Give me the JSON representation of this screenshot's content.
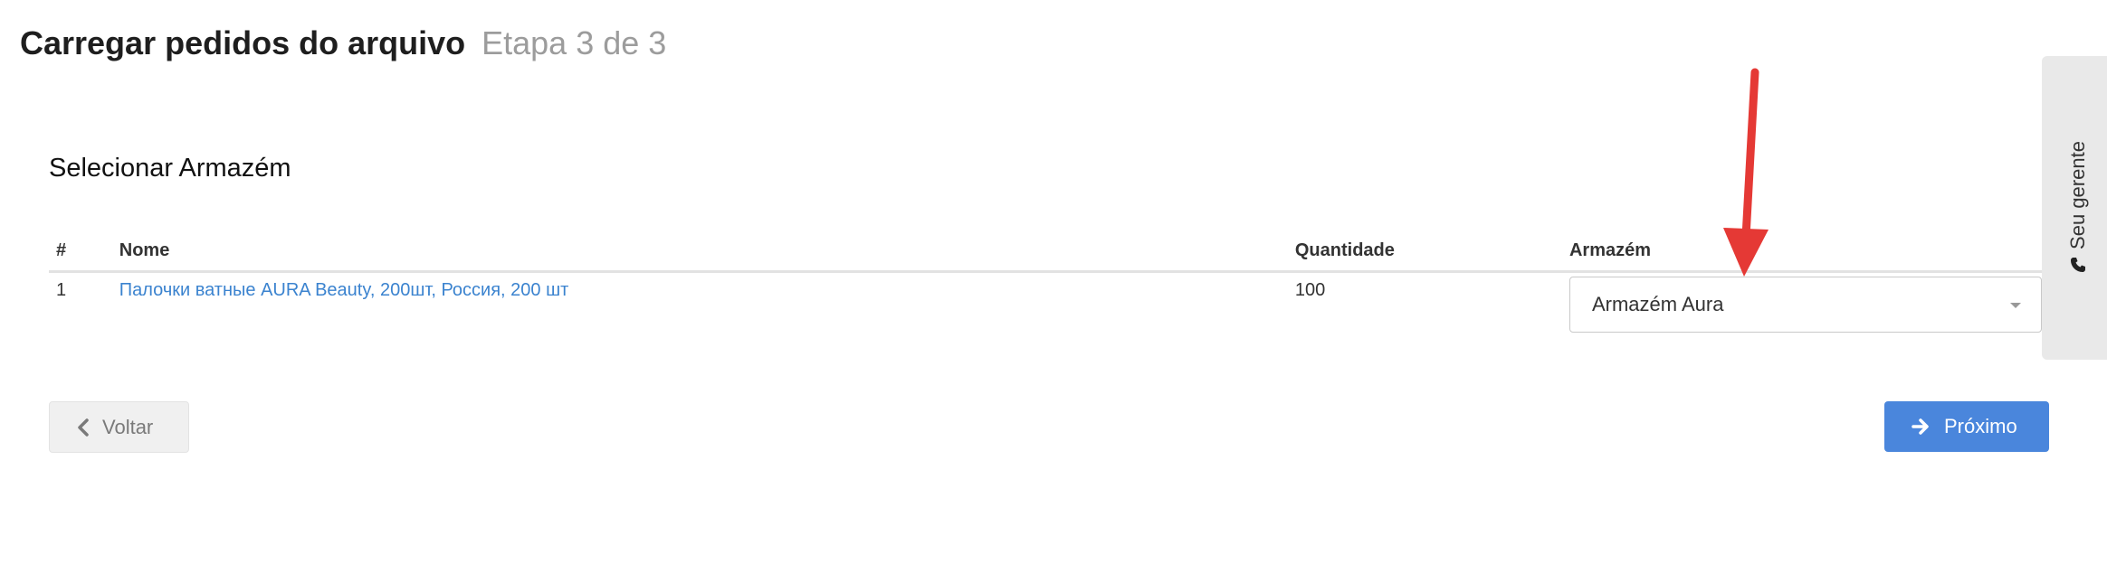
{
  "header": {
    "title": "Carregar pedidos do arquivo",
    "step": "Etapa 3 de 3"
  },
  "section": {
    "title": "Selecionar Armazém"
  },
  "table": {
    "columns": {
      "index": "#",
      "name": "Nome",
      "quantity": "Quantidade",
      "warehouse": "Armazém"
    },
    "rows": [
      {
        "index": "1",
        "name": "Палочки ватные AURA Beauty, 200шт, Россия, 200 шт",
        "quantity": "100",
        "warehouse": "Armazém Aura"
      }
    ]
  },
  "buttons": {
    "back": "Voltar",
    "next": "Próximo"
  },
  "side_tab": {
    "label": "Seu gerente"
  },
  "colors": {
    "link": "#3b83cf",
    "primary": "#4a86dc",
    "annotation": "#e53935"
  },
  "icons": [
    "chevron-left-icon",
    "arrow-right-icon",
    "phone-icon",
    "caret-down-icon"
  ]
}
